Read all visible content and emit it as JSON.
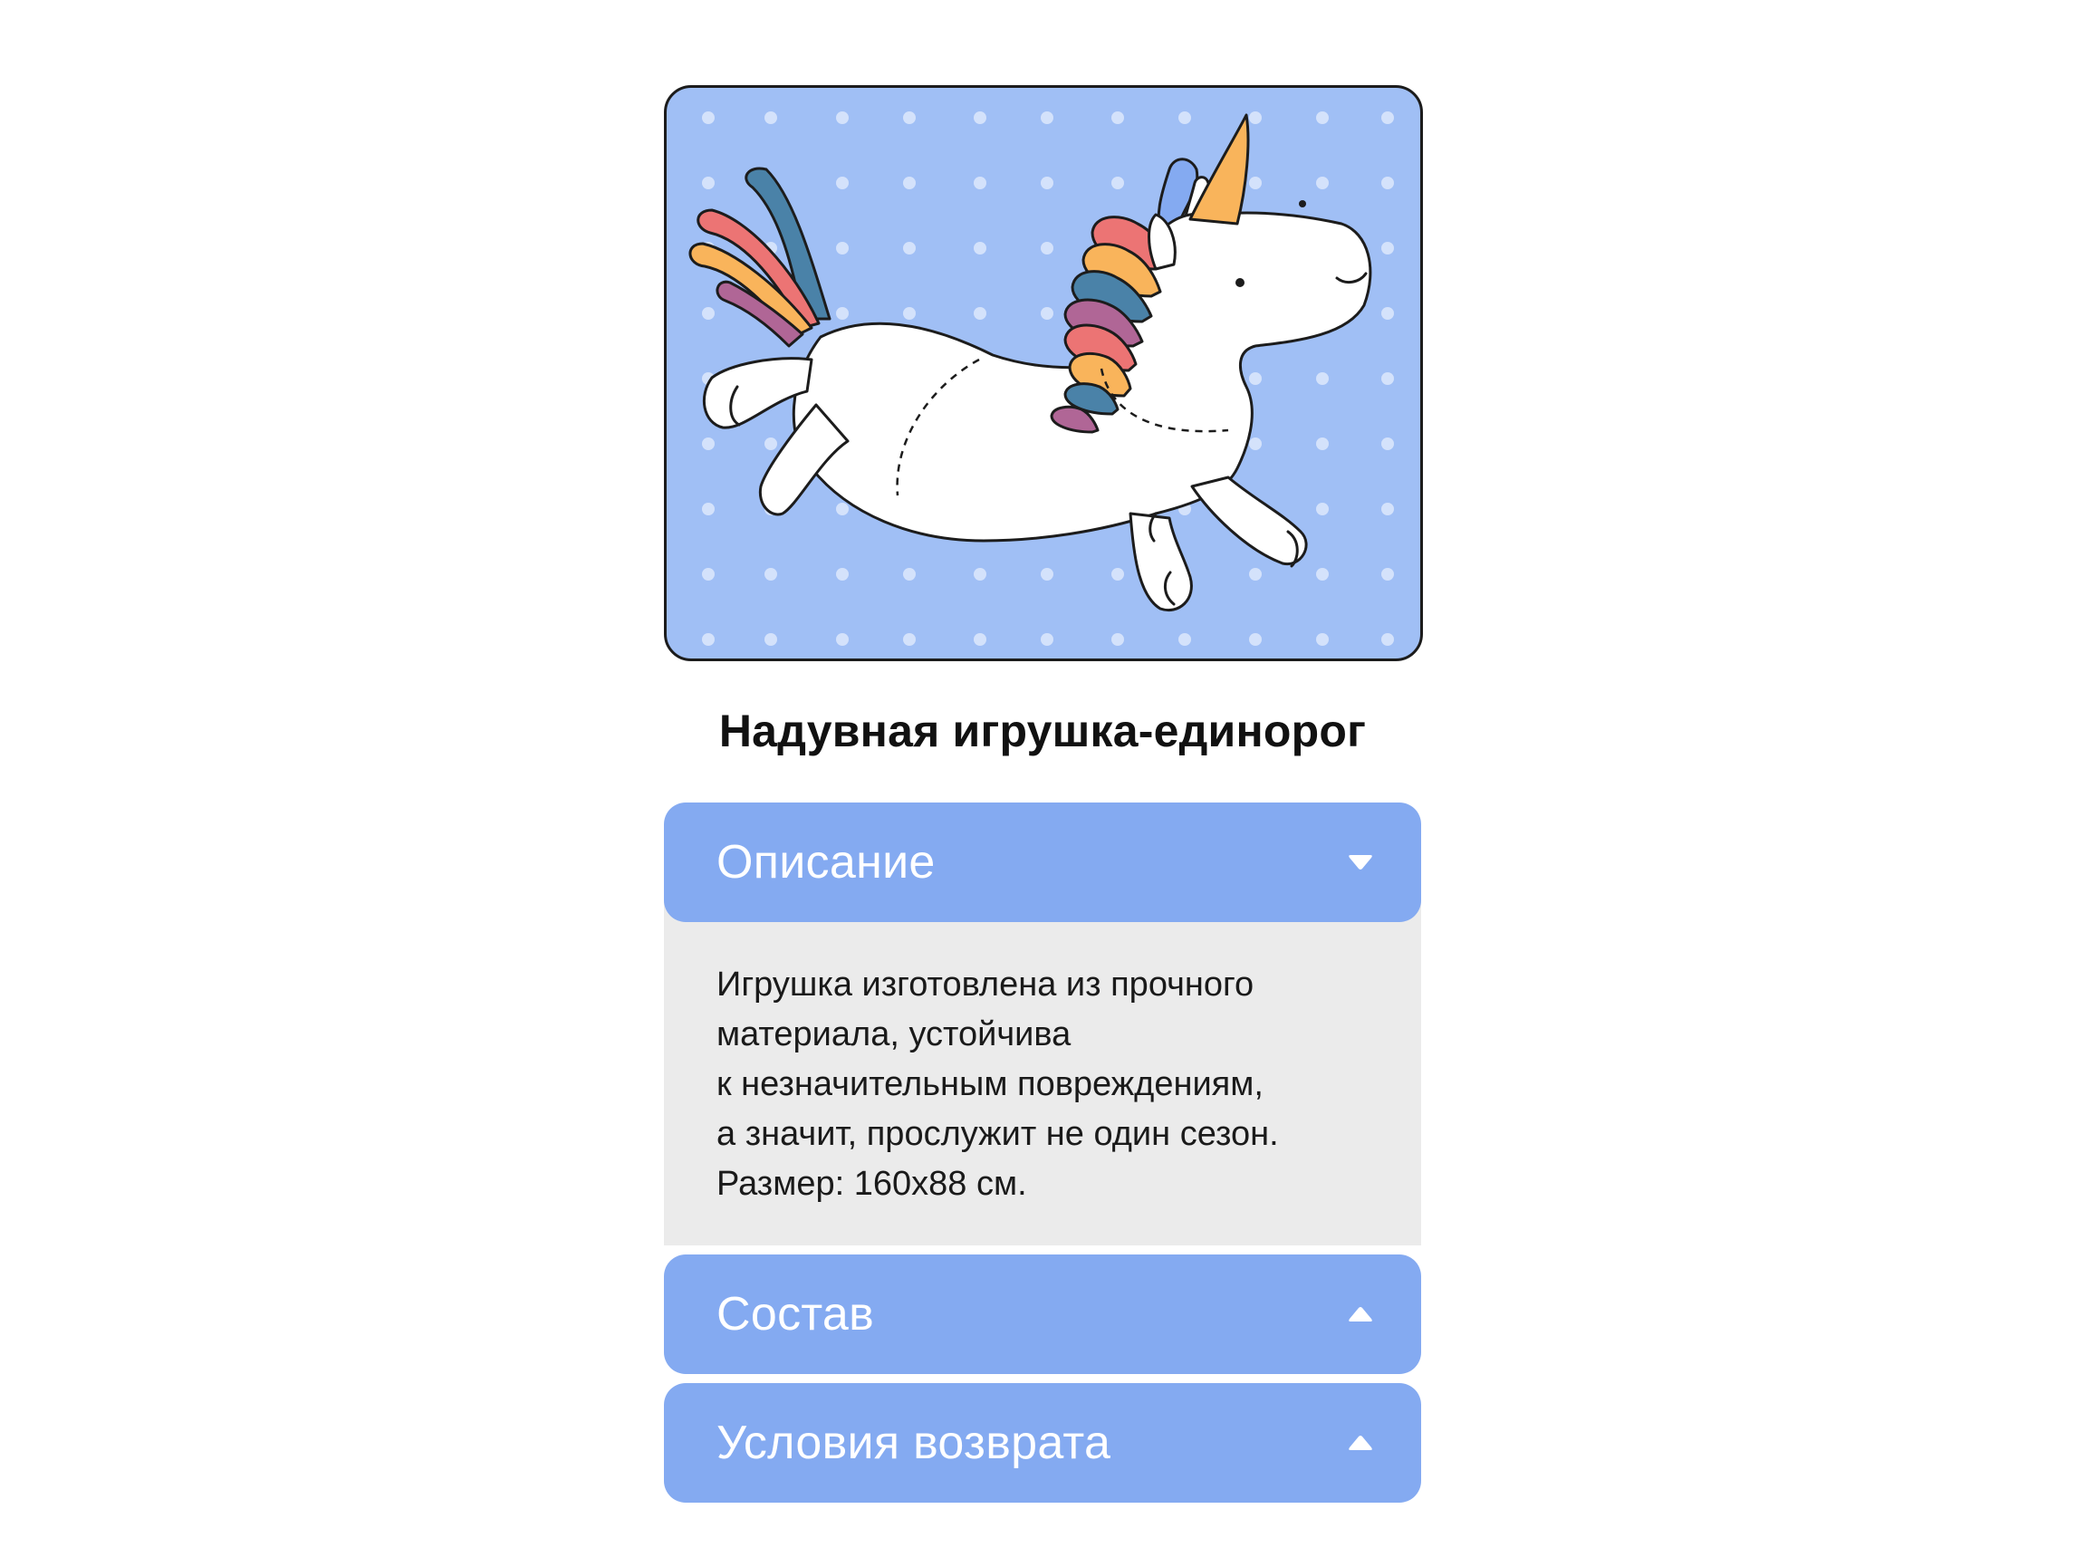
{
  "product": {
    "title": "Надувная игрушка-единорог",
    "image_alt": "unicorn-illustration"
  },
  "accordion": {
    "sections": [
      {
        "title": "Описание",
        "expanded": true,
        "arrow_icon": "caret-down-icon",
        "content_lines": [
          "Игрушка изготовлена из прочного",
          "материала, устойчива",
          "к незначительным повреждениям,",
          "а значит, прослужит не один сезон.",
          "Размер: 160х88 см."
        ]
      },
      {
        "title": "Состав",
        "expanded": false,
        "arrow_icon": "caret-up-icon"
      },
      {
        "title": "Условия возврата",
        "expanded": false,
        "arrow_icon": "caret-up-icon"
      }
    ]
  },
  "colors": {
    "header_bg": "#84aaf1",
    "image_bg": "#a0bff5",
    "body_bg": "#ebebeb",
    "mane_red": "#ec7474",
    "mane_orange": "#f9b45b",
    "mane_teal": "#4a82a8",
    "mane_purple": "#b06696",
    "horn": "#f9b45b"
  }
}
